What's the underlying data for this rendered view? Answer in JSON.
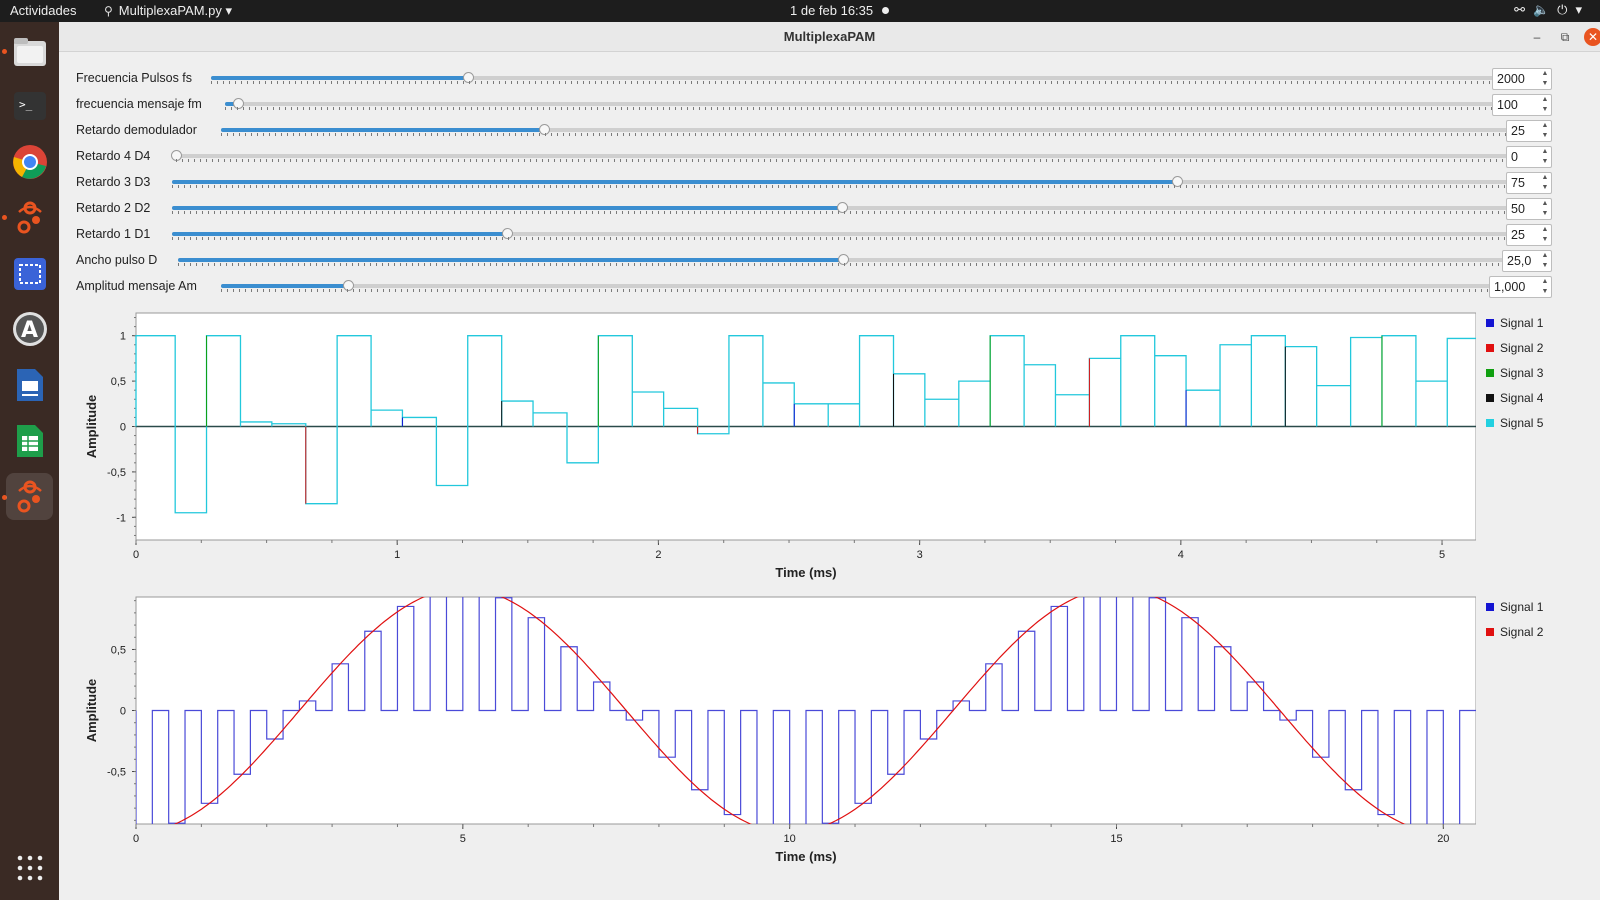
{
  "topbar": {
    "activities": "Actividades",
    "app_menu": "MultiplexaPAM.py",
    "clock": "1 de feb  16:35"
  },
  "window": {
    "title": "MultiplexaPAM"
  },
  "controls": [
    {
      "label": "Frecuencia Pulsos fs",
      "value": "2000",
      "fraction": 0.2
    },
    {
      "label": "frecuencia mensaje fm",
      "value": "100",
      "fraction": 0.01
    },
    {
      "label": "Retardo demodulador",
      "value": "25",
      "fraction": 0.25
    },
    {
      "label": "Retardo 4 D4",
      "value": "0",
      "fraction": 0.0
    },
    {
      "label": "Retardo 3 D3",
      "value": "75",
      "fraction": 0.75
    },
    {
      "label": "Retardo 2 D2",
      "value": "50",
      "fraction": 0.5
    },
    {
      "label": "Retardo 1 D1",
      "value": "25",
      "fraction": 0.25
    },
    {
      "label": "Ancho pulso D",
      "value": "25,0",
      "fraction": 0.5
    },
    {
      "label": "Amplitud mensaje Am",
      "value": "1,000",
      "fraction": 0.1
    }
  ],
  "plot1": {
    "ylabel": "Amplitude",
    "xlabel": "Time (ms)",
    "yticks": [
      "1",
      "0,5",
      "0",
      "-0,5",
      "-1"
    ],
    "xticks": [
      "0",
      "1",
      "2",
      "3",
      "4",
      "5"
    ],
    "legend": [
      {
        "name": "Signal 1",
        "color": "#1414d2"
      },
      {
        "name": "Signal 2",
        "color": "#e01010"
      },
      {
        "name": "Signal 3",
        "color": "#10a010"
      },
      {
        "name": "Signal 4",
        "color": "#111111"
      },
      {
        "name": "Signal 5",
        "color": "#22d0e0"
      }
    ]
  },
  "plot2": {
    "ylabel": "Amplitude",
    "xlabel": "Time (ms)",
    "yticks": [
      "0,5",
      "0",
      "-0,5"
    ],
    "xticks": [
      "0",
      "5",
      "10",
      "15",
      "20"
    ],
    "legend": [
      {
        "name": "Signal 1",
        "color": "#1414d2"
      },
      {
        "name": "Signal 2",
        "color": "#e01010"
      }
    ]
  },
  "chart_data": [
    {
      "type": "line",
      "xlabel": "Time (ms)",
      "ylabel": "Amplitude",
      "xlim": [
        0,
        5.13
      ],
      "ylim": [
        -1.25,
        1.25
      ],
      "series": [
        {
          "name": "Signal 5",
          "x": [
            0,
            0.15,
            0.27,
            0.4,
            0.52,
            0.65,
            0.77,
            0.9,
            1.02,
            1.15,
            1.27,
            1.4,
            1.52,
            1.65,
            1.77,
            1.9,
            2.02,
            2.15,
            2.27,
            2.4,
            2.52,
            2.65,
            2.77,
            2.9,
            3.02,
            3.15,
            3.27,
            3.4,
            3.52,
            3.65,
            3.77,
            3.9,
            4.02,
            4.15,
            4.27,
            4.4,
            4.52,
            4.65,
            4.77,
            4.9,
            5.02
          ],
          "y": [
            1,
            -0.95,
            1,
            0.05,
            0.03,
            -0.85,
            1,
            0.18,
            0.1,
            -0.65,
            1,
            0.28,
            0.15,
            -0.4,
            1,
            0.38,
            0.2,
            -0.08,
            1,
            0.48,
            0.25,
            0.25,
            1,
            0.58,
            0.3,
            0.5,
            1,
            0.68,
            0.35,
            0.75,
            1,
            0.78,
            0.4,
            0.9,
            1,
            0.88,
            0.45,
            0.98,
            1,
            0.5,
            0.97
          ]
        }
      ]
    },
    {
      "type": "line",
      "xlabel": "Time (ms)",
      "ylabel": "Amplitude",
      "xlim": [
        0,
        20.5
      ],
      "ylim": [
        -0.93,
        0.93
      ],
      "series": [
        {
          "name": "Signal 2",
          "function": "sin(2*pi*0.1*(t - 2.5))"
        },
        {
          "name": "Signal 1",
          "pulse_period_ms": 0.5
        }
      ]
    }
  ]
}
